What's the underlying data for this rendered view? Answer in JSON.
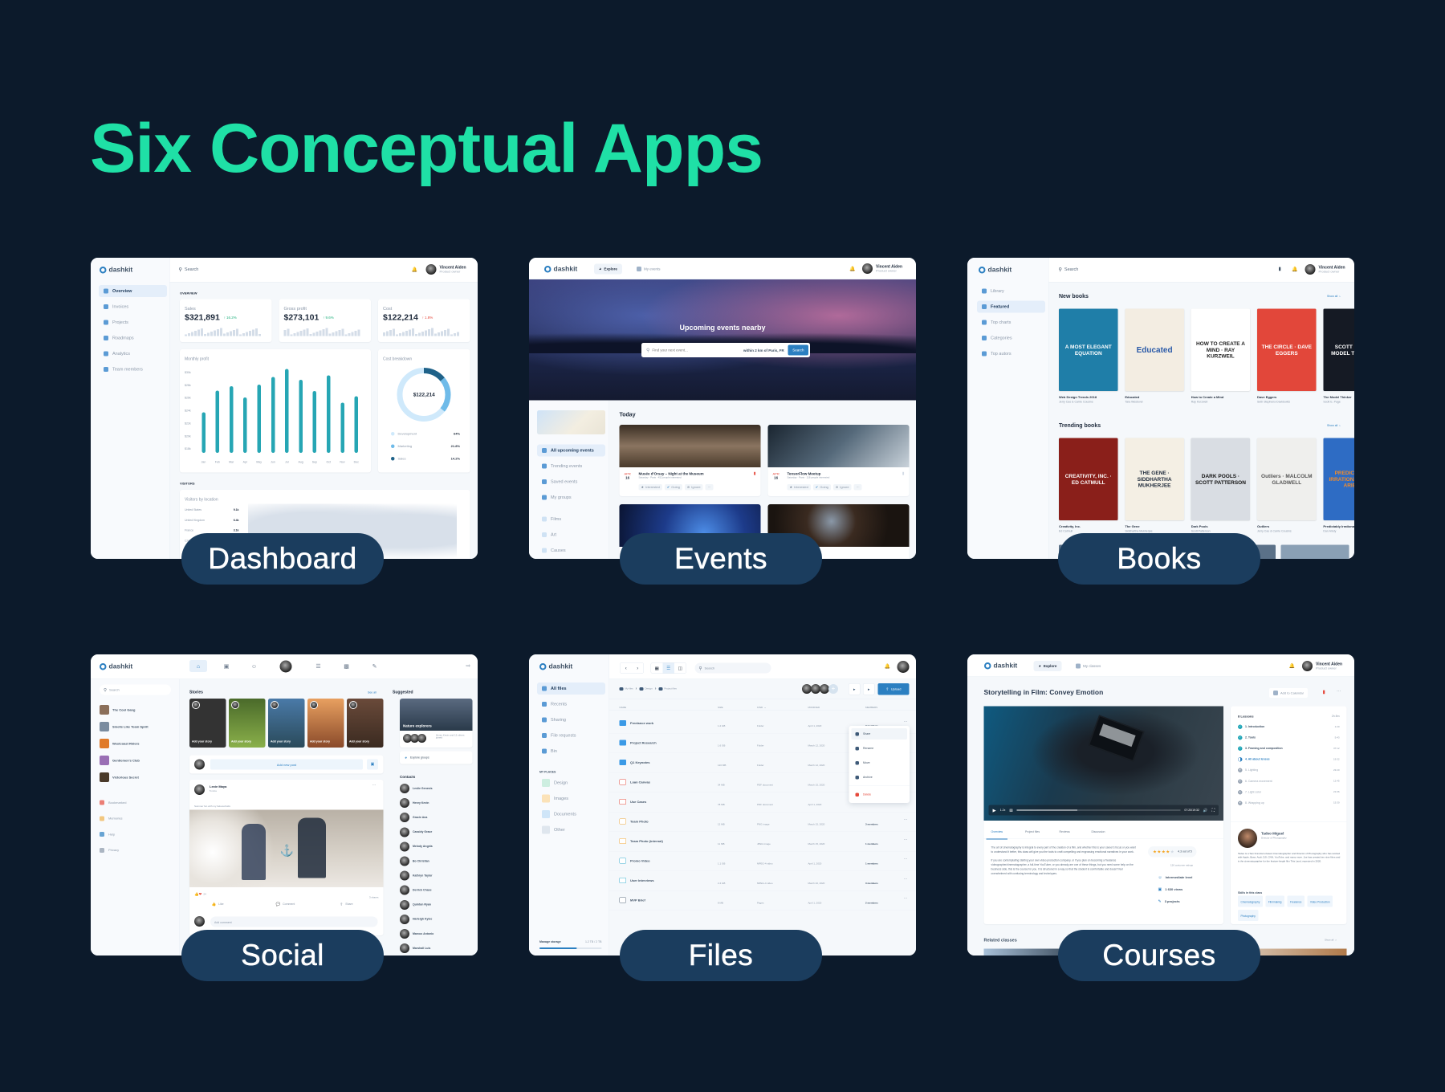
{
  "heading": "Six Conceptual Apps",
  "colors": {
    "background": "#0c1a2b",
    "heading": "#1fe0a6",
    "label_pill": "#1b3d5e",
    "accent": "#2b7fc1",
    "bars": "#26a6b4"
  },
  "brand": "dashkit",
  "user": {
    "name": "Vincent Aiden",
    "role": "Product owner"
  },
  "labels": [
    "Dashboard",
    "Events",
    "Books",
    "Social",
    "Files",
    "Courses"
  ],
  "dashboard": {
    "search": "Search",
    "nav": [
      "Overview",
      "Invoices",
      "Projects",
      "Roadmaps",
      "Analytics",
      "Team members"
    ],
    "overview_label": "OVERVIEW",
    "stats": [
      {
        "label": "Sales",
        "value": "$321,891",
        "change": "16.2%",
        "trend": "up-positive"
      },
      {
        "label": "Gross profit",
        "value": "$273,101",
        "change": "9.6%",
        "trend": "up-positive"
      },
      {
        "label": "Cost",
        "value": "$122,214",
        "change": "1.8%",
        "trend": "up-negative"
      }
    ],
    "monthly_profit": {
      "title": "Monthly profit",
      "yticks": [
        "$30k",
        "$28k",
        "$26k",
        "$24k",
        "$22k",
        "$20k",
        "$18k"
      ],
      "months": [
        "Jan",
        "Feb",
        "Mar",
        "Apr",
        "May",
        "Jun",
        "Jul",
        "Aug",
        "Sep",
        "Oct",
        "Nov",
        "Dec"
      ],
      "values_k": [
        23.4,
        26.8,
        27.5,
        25.7,
        27.7,
        28.9,
        30.2,
        28.5,
        26.7,
        29.2,
        24.9,
        25.9
      ],
      "ylim_k": [
        17,
        30
      ]
    },
    "cost_breakdown": {
      "title": "Cost breakdown",
      "total": "$122,214",
      "items": [
        {
          "label": "Development",
          "value": "64%",
          "pct": 64,
          "color": "#cfe9fb"
        },
        {
          "label": "Marketing",
          "value": "21.8%",
          "pct": 21.8,
          "color": "#6fbbe9"
        },
        {
          "label": "Sales",
          "value": "14.2%",
          "pct": 14.2,
          "color": "#1f6289"
        }
      ]
    },
    "visitors_label": "VISITORS",
    "visitors": {
      "title": "Visitors by location",
      "rows": [
        {
          "country": "United States",
          "value": "9.1k"
        },
        {
          "country": "United Kingdom",
          "value": "6.4k"
        },
        {
          "country": "France",
          "value": "3.1k"
        },
        {
          "country": "Czech",
          "value": ""
        }
      ]
    }
  },
  "events": {
    "tabs": [
      "Explore",
      "My events"
    ],
    "hero_title": "Upcoming events nearby",
    "search_placeholder": "Find your next event...",
    "location": "within 2 km of Paris, FR",
    "search_button": "Search",
    "nav": [
      "All upcoming events",
      "Trending events",
      "Saved events",
      "My groups"
    ],
    "categories": [
      "Films",
      "Art",
      "Causes"
    ],
    "section": "Today",
    "cards": [
      {
        "month": "APR",
        "day": "16",
        "title": "Musée d'Orsay – Night at the Museum",
        "meta": "Saturday · Paris · 452 people interested",
        "saved": true
      },
      {
        "month": "APR",
        "day": "16",
        "title": "TensorFlow Meetup",
        "meta": "Saturday · Paris · 118 people interested",
        "saved": false
      }
    ],
    "actions": [
      "Interested",
      "Going",
      "Ignore",
      "···"
    ],
    "partial_meta": "people interested"
  },
  "books": {
    "search": "Search",
    "nav": [
      "Library",
      "Featured",
      "Top charts",
      "Categories",
      "Top autors"
    ],
    "show_all": "Show all",
    "sections": [
      {
        "title": "New books",
        "items": [
          {
            "title": "Web Design Trends 2018",
            "author": "Jerry Cao & Carrie Cousins",
            "cover": "A MOST ELEGANT EQUATION",
            "bg": "#1f7ea8",
            "fg": "#ffffff"
          },
          {
            "title": "Educated",
            "author": "Tara Westover",
            "cover": "Educated",
            "bg": "#f3ede2",
            "fg": "#2a5aa8"
          },
          {
            "title": "How to Create a Mind",
            "author": "Ray Kurzweil",
            "cover": "HOW TO CREATE A MIND · RAY KURZWEIL",
            "bg": "#ffffff",
            "fg": "#222222"
          },
          {
            "title": "Dave Eggers",
            "author": "Seth Stephens-Davidowitz",
            "cover": "THE CIRCLE · DAVE EGGERS",
            "bg": "#e2473a",
            "fg": "#ffffff"
          },
          {
            "title": "The Model Thinker",
            "author": "Scott E. Page",
            "cover": "SCOTT E. THE MODEL THINKER",
            "bg": "#151a24",
            "fg": "#ffffff"
          }
        ]
      },
      {
        "title": "Trending books",
        "items": [
          {
            "title": "Creativity, Inc.",
            "author": "Ed Catmull",
            "cover": "CREATIVITY, INC. · ED CATMULL",
            "bg": "#8a1f1a",
            "fg": "#ffffff"
          },
          {
            "title": "The Gene",
            "author": "Siddhartha Mukherjee",
            "cover": "THE GENE · SIDDHARTHA MUKHERJEE",
            "bg": "#f4efe4",
            "fg": "#1e2a3b"
          },
          {
            "title": "Dark Pools",
            "author": "Scott Patterson",
            "cover": "DARK POOLS · SCOTT PATTERSON",
            "bg": "#d9dde3",
            "fg": "#111111"
          },
          {
            "title": "Outliers",
            "author": "Jerry Cao & Carrie Cousins",
            "cover": "Outliers · MALCOLM GLADWELL",
            "bg": "#efefed",
            "fg": "#555555"
          },
          {
            "title": "Predictably Irrational",
            "author": "Dan Ariely",
            "cover": "PREDICTABLY IRRATIONAL · DAN ARIELY",
            "bg": "#2e6cc4",
            "fg": "#f28b2a"
          }
        ]
      }
    ]
  },
  "social": {
    "search": "Search",
    "groups": [
      "The Cool Gang",
      "Smells Like Team Spirit",
      "Westcoast Riders",
      "Gentlemen's Club",
      "Victorious Secret"
    ],
    "links": [
      "Bookmarked",
      "Memories",
      "Help",
      "Privacy"
    ],
    "stories_title": "Stories",
    "see_all": "See all",
    "story_label": "Add your story",
    "add_post": "Add new post",
    "post": {
      "author": "Lexie Maya",
      "time": "5 mins",
      "text": "Summer fun with my beloved kids",
      "reactions": "24",
      "shares": "3 shares",
      "actions": [
        "Like",
        "Comment",
        "Share"
      ],
      "comment_placeholder": "Add comment"
    },
    "suggested_title": "Suggested",
    "suggested_group": "Nature explorers",
    "suggested_meta": "Henry Kevin and 12 others joined",
    "explore_groups": "Explore groups",
    "contacts_title": "Contacts",
    "contacts": [
      "Leslie Genesis",
      "Henry Kevin",
      "Gracie Ana",
      "Cassidy Grace",
      "Melody Angela",
      "Bo Christian",
      "Kathryn Taylor",
      "Derrick Chase",
      "Quinton Ryan",
      "Harleigh Kylee",
      "Marcus Antonio",
      "Marshall Luis"
    ]
  },
  "files": {
    "search": "Search",
    "nav": [
      "All files",
      "Recents",
      "Sharing",
      "File requests",
      "Bin"
    ],
    "places_title": "MY PLACES",
    "places": [
      "Design",
      "Images",
      "Documents",
      "Other"
    ],
    "storage_label": "Manage storage",
    "storage_value": "1.2 TB / 2 TB",
    "storage_pct": 60,
    "breadcrumb": [
      "My files",
      "Design",
      "Project files"
    ],
    "upload": "Upload",
    "columns": [
      "NAME",
      "SIZE",
      "KIND",
      "MODIFIED",
      "MEMBERS"
    ],
    "rows": [
      {
        "name": "Freelance work",
        "size": "1.2 GB",
        "kind": "Folder",
        "modified": "April 1, 2020",
        "members": "3 members",
        "type": "folder"
      },
      {
        "name": "Project Research",
        "size": "1.6 GB",
        "kind": "Folder",
        "modified": "March 12, 2020",
        "members": "",
        "type": "folder"
      },
      {
        "name": "Q1 Keynotes",
        "size": "120 MB",
        "kind": "Folder",
        "modified": "March 12, 2020",
        "members": "",
        "type": "folder"
      },
      {
        "name": "Loan Canvas",
        "size": "34 MB",
        "kind": "PDF document",
        "modified": "March 15, 2020",
        "members": "",
        "type": "pdf"
      },
      {
        "name": "Use Cases",
        "size": "78 MB",
        "kind": "PDF document",
        "modified": "April 1, 2020",
        "members": "",
        "type": "pdf"
      },
      {
        "name": "Team Photo",
        "size": "12 MB",
        "kind": "PNG image",
        "modified": "March 15, 2020",
        "members": "3 members",
        "type": "image"
      },
      {
        "name": "Team Photo (internal)",
        "size": "11 MB",
        "kind": "JPEG image",
        "modified": "March 15, 2020",
        "members": "1 members",
        "type": "image"
      },
      {
        "name": "Promo Video",
        "size": "1.1 GB",
        "kind": "MPEG-4 video",
        "modified": "April 1, 2020",
        "members": "1 members",
        "type": "video"
      },
      {
        "name": "User Interviews",
        "size": "2.4 GB",
        "kind": "MPEG-4 video",
        "modified": "March 20, 2020",
        "members": "3 members",
        "type": "video"
      },
      {
        "name": "MVP Brief",
        "size": "8 MB",
        "kind": "Pages",
        "modified": "April 1, 2020",
        "members": "2 members",
        "type": "doc"
      }
    ],
    "menu": [
      "Share",
      "Rename",
      "Move",
      "Archive",
      "Delete"
    ]
  },
  "courses": {
    "tabs": [
      "Explore",
      "My classes"
    ],
    "title": "Storytelling in Film: Convey Emotion",
    "add_calendar": "Add to Calendar",
    "speed": "1.2x",
    "time": "07:20/19:32",
    "progress_pct": 37,
    "content_tabs": [
      "Overview",
      "Project files",
      "Reviews",
      "Discussion"
    ],
    "paragraphs": [
      "The art of cinematography is integral to every part of the creation of a film, and whether this is your career's focus or you want to understand it better, this class will give you the tools to craft compelling and engrossing emotional narratives in your work.",
      "If you are contemplating starting your own video production company, or if you plan on becoming a freelance videographer/cinematographer, a full-time YouTuber, or you already are one of these things, but you need some help on the business side, this is the course for you. It is structured in a way so that the student is comfortable and doesn't feel overwhelmed with confusing terminology and techniques."
    ],
    "rating": "4.3 out of 5",
    "rating_value": 4.3,
    "ratings_count": "126 customer ratings",
    "facts": [
      "Intermediate level",
      "1 630 views",
      "3 projects"
    ],
    "lessons_title": "8 Lessons",
    "lessons_total": "2h 8m",
    "lessons": [
      {
        "name": "1. Introduction",
        "time": "1:20",
        "state": "done"
      },
      {
        "name": "2. Tools",
        "time": "5:43",
        "state": "done"
      },
      {
        "name": "3. Framing and composition",
        "time": "37:12",
        "state": "done"
      },
      {
        "name": "4. All about lenses",
        "time": "19:32",
        "state": "current"
      },
      {
        "name": "5. Lighting",
        "time": "23:20",
        "state": "todo"
      },
      {
        "name": "6. Camera movement",
        "time": "12:45",
        "state": "todo"
      },
      {
        "name": "7. Light color",
        "time": "21:06",
        "state": "todo"
      },
      {
        "name": "8. Wrapping up",
        "time": "15:30",
        "state": "todo"
      }
    ],
    "instructor": {
      "name": "Tadeo Miguel",
      "role": "Director of Photography",
      "bio": "Tadeo is a San Francisco-based cinematographer and Director of Photography who has worked with Apple, Bose, Audi, DJI, CNN, YouTube, and many more. Joe has created ten nine films and is the cinematographer for the feature-length film This Land, expected in 2020."
    },
    "skills_title": "Skills in this class",
    "skills": [
      "Cinematography",
      "Filmmaking",
      "Freelance",
      "Video Production",
      "Photography"
    ],
    "related": "Related classes",
    "show_all": "Show all"
  }
}
